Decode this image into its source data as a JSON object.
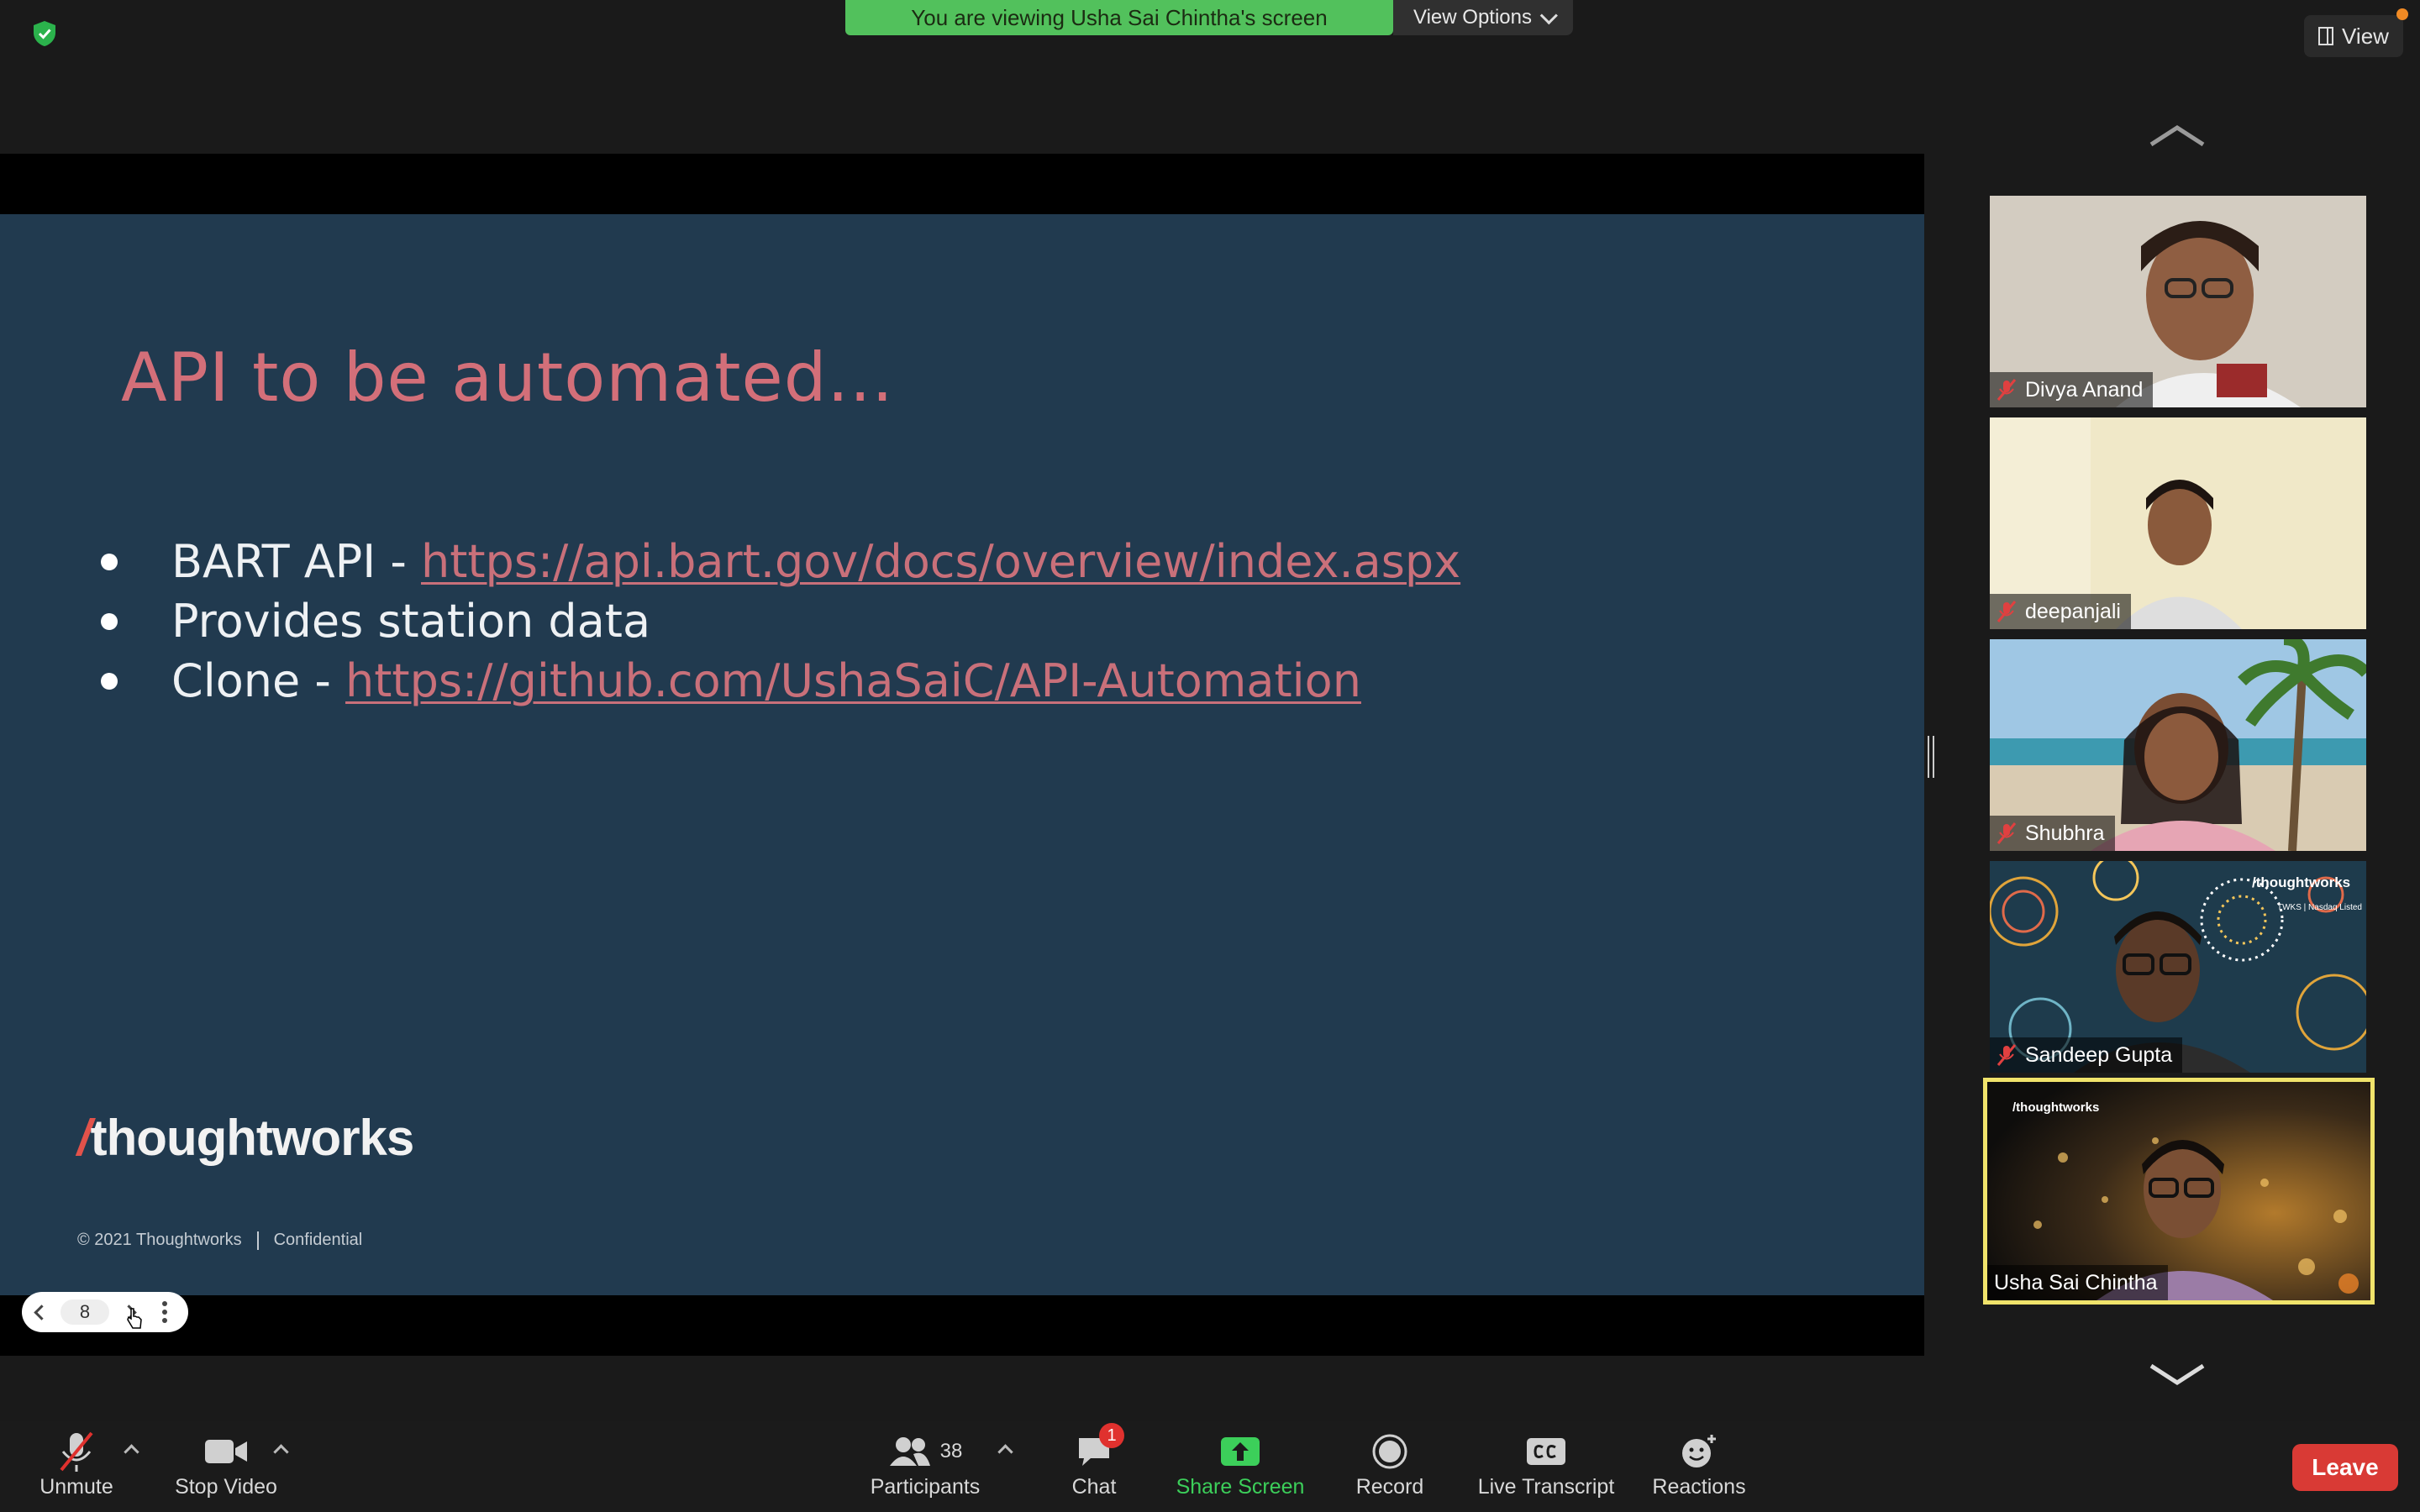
{
  "banner": {
    "text": "You are viewing Usha Sai Chintha's screen",
    "view_options": "View Options"
  },
  "top_right": {
    "view_label": "View"
  },
  "slide": {
    "title": "API to be automated...",
    "bullets": [
      {
        "text": "BART API - ",
        "link": "https://api.bart.gov/docs/overview/index.aspx"
      },
      {
        "text": "Provides station data",
        "link": ""
      },
      {
        "text": "Clone - ",
        "link": "https://github.com/UshaSaiC/API-Automation"
      }
    ],
    "logo": {
      "slash": "/",
      "word": "thoughtworks"
    },
    "footer": {
      "copyright": "© 2021 Thoughtworks",
      "confidential": "Confidential"
    }
  },
  "slide_nav": {
    "page": "8"
  },
  "participants": [
    {
      "name": "Divya Anand",
      "muted": true
    },
    {
      "name": "deepanjali",
      "muted": true
    },
    {
      "name": "Shubhra",
      "muted": true
    },
    {
      "name": "Sandeep Gupta",
      "muted": true
    },
    {
      "name": "Usha Sai Chintha",
      "muted": false,
      "active_speaker": true
    }
  ],
  "tile_overlays": {
    "tw_logo_small": "/thoughtworks",
    "twks_text": "TWKS | Nasdaq Listed"
  },
  "toolbar": {
    "unmute": "Unmute",
    "stop_video": "Stop Video",
    "participants": "Participants",
    "participant_count": "38",
    "chat": "Chat",
    "chat_badge": "1",
    "share_screen": "Share Screen",
    "record": "Record",
    "live_transcript": "Live Transcript",
    "reactions": "Reactions",
    "leave": "Leave"
  },
  "colors": {
    "slide_bg": "#213a4f",
    "title_pink": "#d36f79",
    "banner_green": "#52c15c",
    "leave_red": "#d93a35",
    "share_green": "#3ccf5a",
    "active_border": "#f0e36b"
  }
}
